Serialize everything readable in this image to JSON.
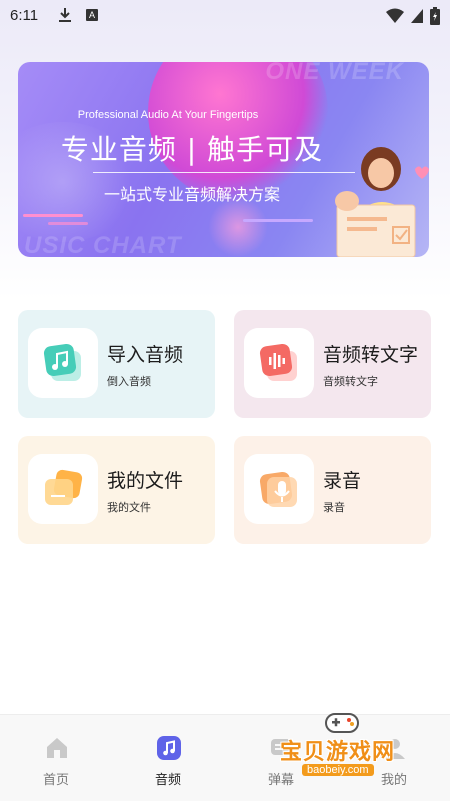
{
  "status_bar": {
    "time": "6:11",
    "a_badge": "A"
  },
  "banner": {
    "subtitle_en": "Professional Audio  At Your Fingertips",
    "title": "专业音频 | 触手可及",
    "tagline": "一站式专业音频解决方案",
    "bg_text_top": "ONE WEEK",
    "bg_text_bottom": "USIC CHART"
  },
  "cards": [
    {
      "title": "导入音频",
      "subtitle": "倒入音频",
      "icon": "music-note-icon"
    },
    {
      "title": "音频转文字",
      "subtitle": "音频转文字",
      "icon": "waveform-icon"
    },
    {
      "title": "我的文件",
      "subtitle": "我的文件",
      "icon": "folder-icon"
    },
    {
      "title": "录音",
      "subtitle": "录音",
      "icon": "microphone-icon"
    }
  ],
  "tabs": [
    {
      "label": "首页",
      "icon": "home-icon",
      "active": false
    },
    {
      "label": "音频",
      "icon": "audio-icon",
      "active": true
    },
    {
      "label": "弹幕",
      "icon": "danmaku-icon",
      "active": false
    },
    {
      "label": "我的",
      "icon": "profile-icon",
      "active": false
    }
  ],
  "watermark": {
    "text": "宝贝游戏网",
    "url": "baobeiy.com"
  },
  "colors": {
    "accent": "#6a5ae0",
    "banner_start": "#a58cf7",
    "card_teal": "#e7f4f6",
    "card_pink": "#f4e7ee",
    "card_cream": "#fdf4e6",
    "watermark_orange": "#f08f18"
  }
}
